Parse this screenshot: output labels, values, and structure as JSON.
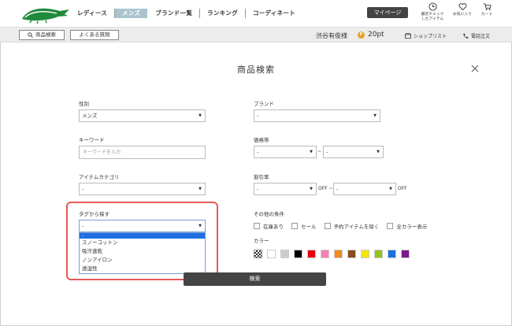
{
  "header": {
    "nav": [
      "レディース",
      "メンズ",
      "ブランド一覧",
      "ランキング",
      "コーディネート"
    ],
    "active_nav": 1,
    "mypage": "マイページ",
    "icons": [
      {
        "label": "最近チェック\nしたアイテム",
        "icon": "clock-icon"
      },
      {
        "label": "お気に入り",
        "icon": "heart-icon"
      },
      {
        "label": "カート",
        "icon": "cart-icon"
      }
    ]
  },
  "subbar": {
    "search_btn": "商品検索",
    "faq_btn": "よくある質問",
    "user_name": "渋谷有俊様",
    "coin_mark": "P",
    "points": "20pt",
    "shop_list": "ショップリスト",
    "phone_order": "電話注文"
  },
  "form": {
    "title": "商品検索",
    "gender_label": "性別",
    "gender_value": "メンズ",
    "brand_label": "ブランド",
    "brand_value": "-",
    "keyword_label": "キーワード",
    "keyword_placeholder": "キーワードを入力",
    "price_label": "価格帯",
    "price_min": "-",
    "price_sep": "~",
    "price_max": "-",
    "category_label": "アイテムカテゴリ",
    "category_value": "-",
    "discount_label": "割引率",
    "discount_min": "-",
    "discount_off1": "OFF ~",
    "discount_max": "-",
    "discount_off2": "OFF",
    "tag_label": "タグから探す",
    "tag_value": "-",
    "tag_options": [
      "-",
      "スノーコットン",
      "吸汗速乾",
      "ノンアイロン",
      "透湿性"
    ],
    "other_label": "その他の条件",
    "checks": [
      "在庫あり",
      "セール",
      "予約アイテムを除く",
      "全カラー表示"
    ],
    "color_label": "カラー",
    "colors": [
      "#ffffff",
      "#cccccc",
      "#000000",
      "#e60012",
      "#f57db3",
      "#f08a1c",
      "#8a4b1a",
      "#f2e600",
      "#8fc31f",
      "#1e6fe0",
      "#7d1a8c"
    ],
    "submit": "検索"
  }
}
